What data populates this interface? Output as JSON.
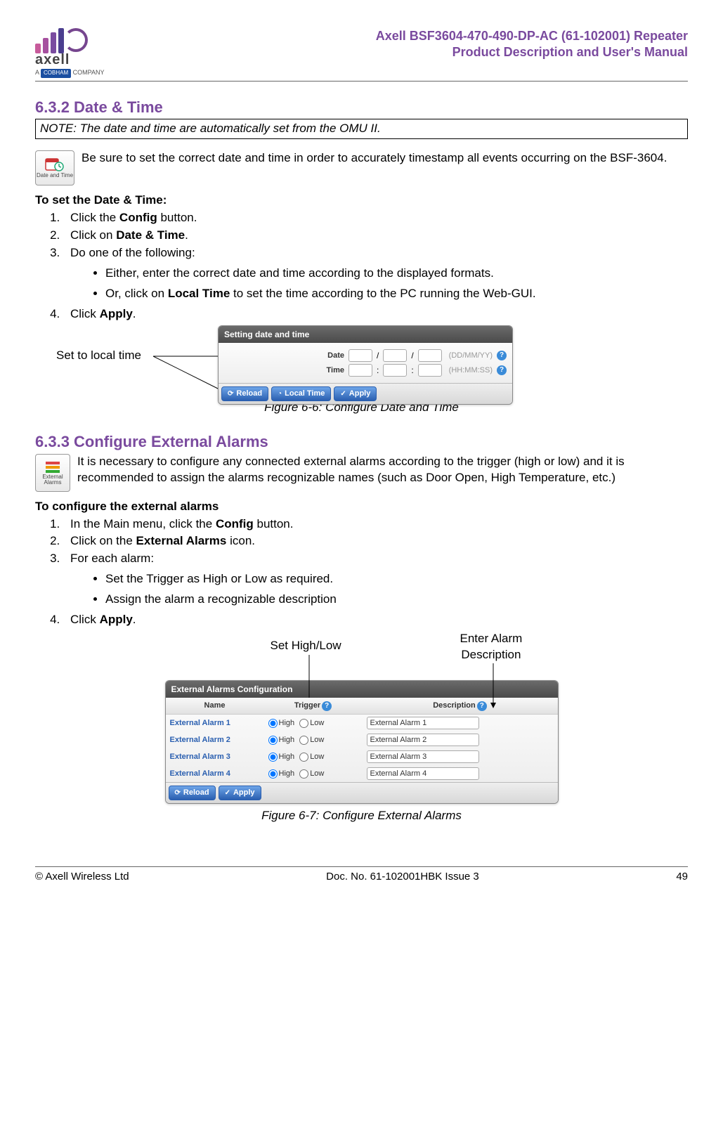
{
  "header": {
    "brand_name": "axell",
    "brand_sub_prefix": "A ",
    "brand_sub_company": "COBHAM",
    "brand_sub_suffix": " COMPANY",
    "doc_title_line1": "Axell BSF3604-470-490-DP-AC (61-102001) Repeater",
    "doc_title_line2": "Product Description and User's Manual"
  },
  "s632": {
    "heading": "6.3.2   Date & Time",
    "note": "NOTE: The date and time are automatically set from the OMU II.",
    "icon_label": "Date and Time",
    "intro": "Be sure to set the correct date and time in order to accurately timestamp all events occurring on the BSF-3604.",
    "procedure_title": "To set the Date & Time:",
    "steps": [
      {
        "pre": "Click the ",
        "bold": "Config",
        "post": " button."
      },
      {
        "pre": "Click on ",
        "bold": "Date & Time",
        "post": "."
      },
      {
        "pre": "Do one of the following:",
        "bold": "",
        "post": ""
      }
    ],
    "sub_bullets": [
      "Either, enter the correct date and time according to the displayed formats.",
      {
        "pre": "Or, click on ",
        "bold": "Local Time",
        "post": " to set the time according to the PC running the Web-GUI."
      }
    ],
    "step4": {
      "pre": "Click ",
      "bold": "Apply",
      "post": "."
    },
    "callout": "Set to local time",
    "figure_caption": "Figure 6-6:  Configure Date and Time",
    "panel": {
      "title": "Setting date and time",
      "date_label": "Date",
      "date_hint": "(DD/MM/YY)",
      "time_label": "Time",
      "time_hint": "(HH:MM:SS)",
      "btn_reload": "Reload",
      "btn_local": "Local Time",
      "btn_apply": "Apply"
    }
  },
  "s633": {
    "heading": "6.3.3   Configure External Alarms",
    "icon_label": "External Alarms",
    "intro": "It is necessary to configure any connected external alarms according to the trigger (high or low) and it is recommended to assign the alarms recognizable names (such as Door Open, High Temperature, etc.)",
    "procedure_title": "To configure the external alarms",
    "steps": [
      {
        "pre": "In the Main menu, click the ",
        "bold": "Config",
        "post": " button."
      },
      {
        "pre": "Click on the ",
        "bold": "External Alarms",
        "post": " icon."
      },
      {
        "pre": "For each alarm:",
        "bold": "",
        "post": ""
      }
    ],
    "sub_bullets": [
      "Set the Trigger as High or Low as required.",
      "Assign the alarm a recognizable description"
    ],
    "step4": {
      "pre": "Click ",
      "bold": "Apply",
      "post": "."
    },
    "callout_left": "Set High/Low",
    "callout_right_l1": "Enter Alarm",
    "callout_right_l2": "Description",
    "figure_caption": "Figure 6-7:  Configure External Alarms",
    "panel": {
      "title": "External Alarms Configuration",
      "col_name": "Name",
      "col_trigger": "Trigger",
      "col_desc": "Description",
      "opt_high": "High",
      "opt_low": "Low",
      "rows": [
        {
          "name": "External Alarm 1",
          "desc": "External Alarm 1"
        },
        {
          "name": "External Alarm 2",
          "desc": "External Alarm 2"
        },
        {
          "name": "External Alarm 3",
          "desc": "External Alarm 3"
        },
        {
          "name": "External Alarm 4",
          "desc": "External Alarm 4"
        }
      ],
      "btn_reload": "Reload",
      "btn_apply": "Apply"
    }
  },
  "footer": {
    "left": "© Axell Wireless Ltd",
    "center": "Doc. No. 61-102001HBK Issue 3",
    "right": "49"
  }
}
